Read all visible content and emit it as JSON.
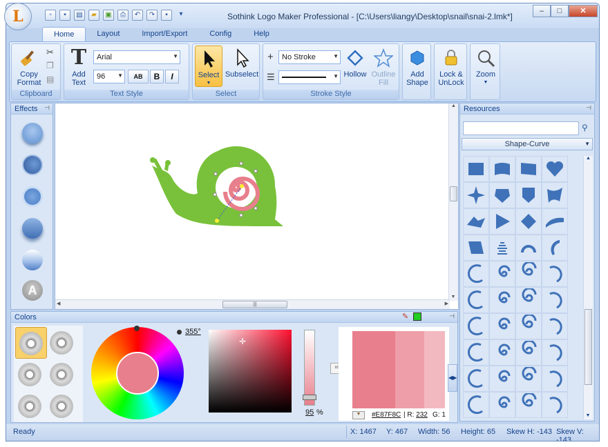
{
  "app": {
    "title": "Sothink Logo Maker Professional - [C:\\Users\\liangy\\Desktop\\snail\\snai-2.lmk*]",
    "logo_letter": "L"
  },
  "quick_access": [
    "new-icon",
    "save-icon",
    "export-icon",
    "open-icon",
    "image-icon",
    "print-icon",
    "undo-icon",
    "redo-icon",
    "save-as-icon",
    "customize-icon"
  ],
  "window_controls": {
    "minimize": "–",
    "maximize": "□",
    "close": "✕"
  },
  "tabs": [
    {
      "label": "Home",
      "active": true
    },
    {
      "label": "Layout",
      "active": false
    },
    {
      "label": "Import/Export",
      "active": false
    },
    {
      "label": "Config",
      "active": false
    },
    {
      "label": "Help",
      "active": false
    }
  ],
  "ribbon": {
    "clipboard": {
      "label": "Clipboard",
      "copy_format": "Copy\nFormat"
    },
    "text_style": {
      "label": "Text Style",
      "add_text": "Add\nText",
      "font": "Arial",
      "size": "96",
      "bold": "B",
      "italic": "I",
      "ab": "AB"
    },
    "select": {
      "label": "Select",
      "select": "Select",
      "subselect": "Subselect"
    },
    "stroke_style": {
      "label": "Stroke Style",
      "stroke": "No Stroke",
      "hollow": "Hollow",
      "outline_fill": "Outline\nFill"
    },
    "add_shape": "Add\nShape",
    "lock_unlock": "Lock &\nUnLock",
    "zoom": "Zoom"
  },
  "effects": {
    "title": "Effects"
  },
  "resources": {
    "title": "Resources",
    "search_placeholder": "",
    "category": "Shape-Curve"
  },
  "colors": {
    "title": "Colors",
    "hue_value": "355°",
    "opacity_value": "95",
    "opacity_unit": "%",
    "hex": "#E87F8C",
    "r_label": "R:",
    "r_value": "232",
    "g_label": "G:",
    "g_value": "1",
    "accent": "#E87F8C",
    "swatch_green": "#22cc22"
  },
  "status": {
    "ready": "Ready",
    "x": "X: 1467",
    "y": "Y: 467",
    "width": "Width: 56",
    "height": "Height: 65",
    "skew_h": "Skew H: -143",
    "skew_v": "Skew V: -143"
  }
}
